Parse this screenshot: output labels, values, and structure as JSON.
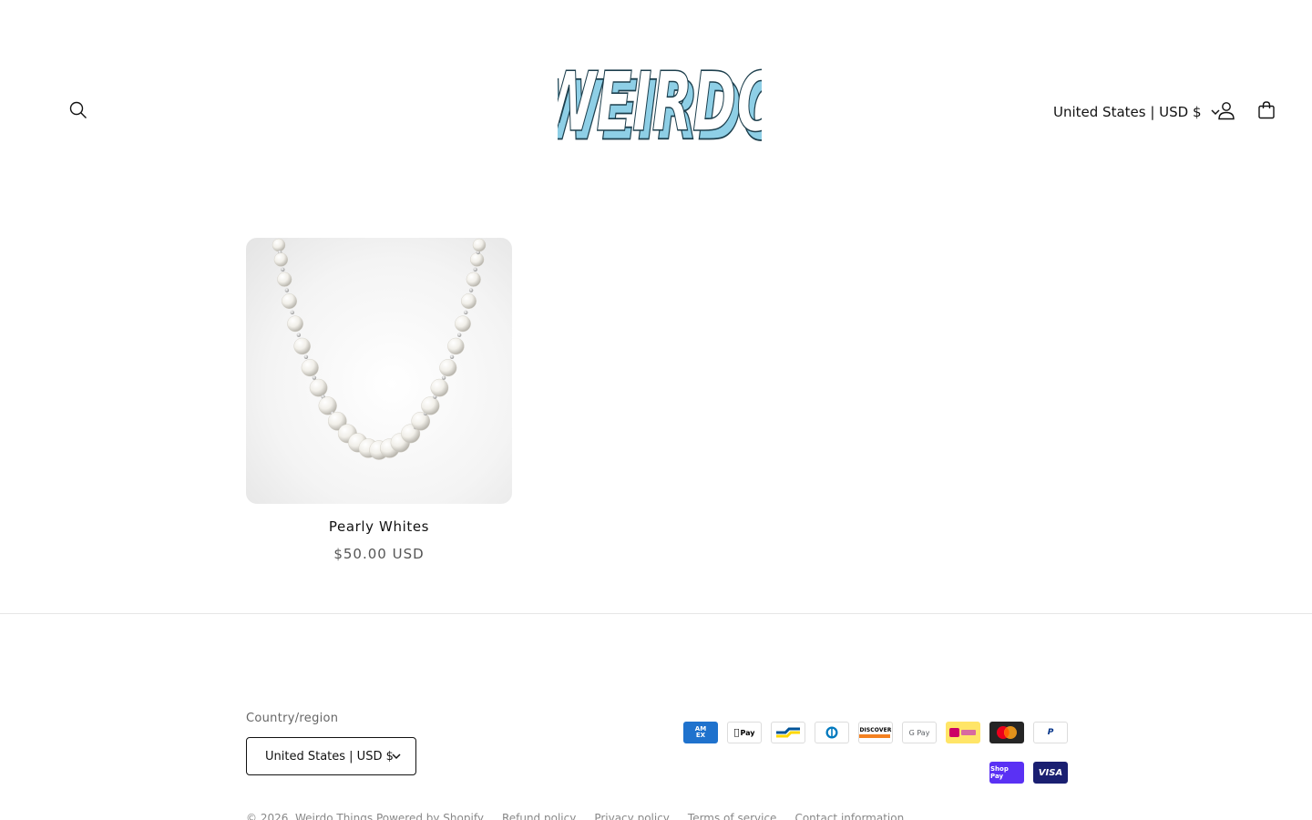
{
  "header": {
    "logo_text": "WEIRDO",
    "currency_label": "United States | USD $",
    "icons": {
      "search": "search-icon",
      "account": "account-icon",
      "cart": "cart-icon",
      "chevron": "chevron-down-icon"
    }
  },
  "product": {
    "title": "Pearly Whites",
    "price": "$50.00 USD",
    "image": "pearl-necklace-image"
  },
  "footer": {
    "region_label": "Country/region",
    "region_value": "United States | USD $",
    "payment_methods": [
      "American Express",
      "Apple Pay",
      "Bancontact",
      "Diners Club",
      "Discover",
      "Google Pay",
      "iDEAL",
      "Mastercard",
      "PayPal",
      "Shop Pay",
      "Visa"
    ],
    "payment_labels": {
      "amex_top": "AM",
      "amex_bottom": "EX",
      "applepay": "Pay",
      "discover": "DISCOVER",
      "gpay": "G Pay",
      "paypal": "P",
      "shoppay": "Shop Pay",
      "visa": "VISA"
    },
    "copyright": "© 2026, Weirdo Things",
    "powered_by": "Powered by Shopify",
    "links": [
      "Refund policy",
      "Privacy policy",
      "Terms of service",
      "Contact information"
    ]
  },
  "colors": {
    "text": "#121212",
    "muted": "#666666",
    "logo_fill": "#ffffff",
    "logo_shadow": "#8ecfe6",
    "divider": "#e6e6e6"
  }
}
